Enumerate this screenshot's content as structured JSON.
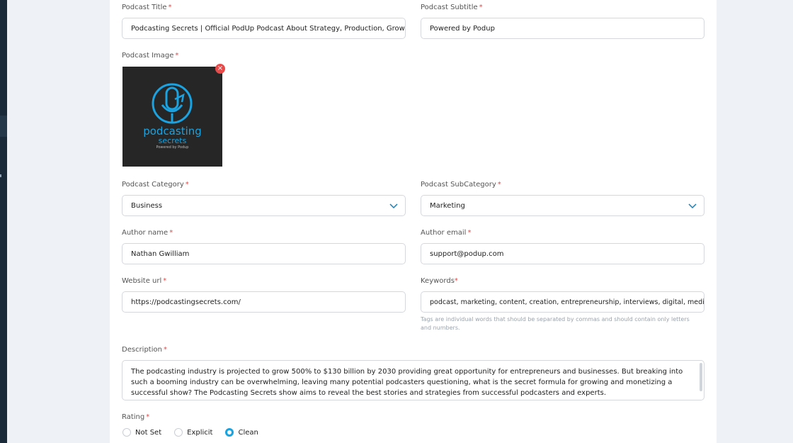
{
  "form": {
    "podcast_title": {
      "label": "Podcast Title",
      "value": "Podcasting Secrets | Official PodUp Podcast About Strategy, Production, Growth and"
    },
    "podcast_subtitle": {
      "label": "Podcast Subtitle",
      "value": "Powered by Podup"
    },
    "podcast_image": {
      "label": "Podcast Image",
      "image_text_main": "podcasting",
      "image_text_sub": "secrets",
      "image_text_tag": "Powered by Podup",
      "remove_glyph": "×"
    },
    "category": {
      "label": "Podcast Category",
      "value": "Business"
    },
    "subcategory": {
      "label": "Podcast SubCategory",
      "value": "Marketing"
    },
    "author_name": {
      "label": "Author name",
      "value": "Nathan Gwilliam"
    },
    "author_email": {
      "label": "Author email",
      "value": "support@podup.com"
    },
    "website_url": {
      "label": "Website url",
      "value": "https://podcastingsecrets.com/"
    },
    "keywords": {
      "label": "Keywords",
      "value": "podcast, marketing, content, creation, entrepreneurship, interviews, digital, media",
      "hint": "Tags are individual words that should be separated by commas and should contain only letters and numbers."
    },
    "description": {
      "label": "Description",
      "value": "The podcasting industry is projected to grow 500% to $130 billion by 2030 providing great opportunity for entrepreneurs and businesses. But breaking into such a booming industry can be overwhelming, leaving many potential podcasters questioning, what is the secret formula for growing and monetizing a successful show? The Podcasting Secrets show aims to reveal the best stories and strategies from successful podcasters and experts."
    },
    "rating": {
      "label": "Rating",
      "options": [
        {
          "label": "Not Set",
          "selected": false
        },
        {
          "label": "Explicit",
          "selected": false
        },
        {
          "label": "Clean",
          "selected": true
        }
      ]
    },
    "required_mark": "*"
  },
  "colors": {
    "accent": "#1aa3e0",
    "required": "#e14a4a",
    "sidebar": "#1b2a38",
    "image_bg": "#262626"
  }
}
